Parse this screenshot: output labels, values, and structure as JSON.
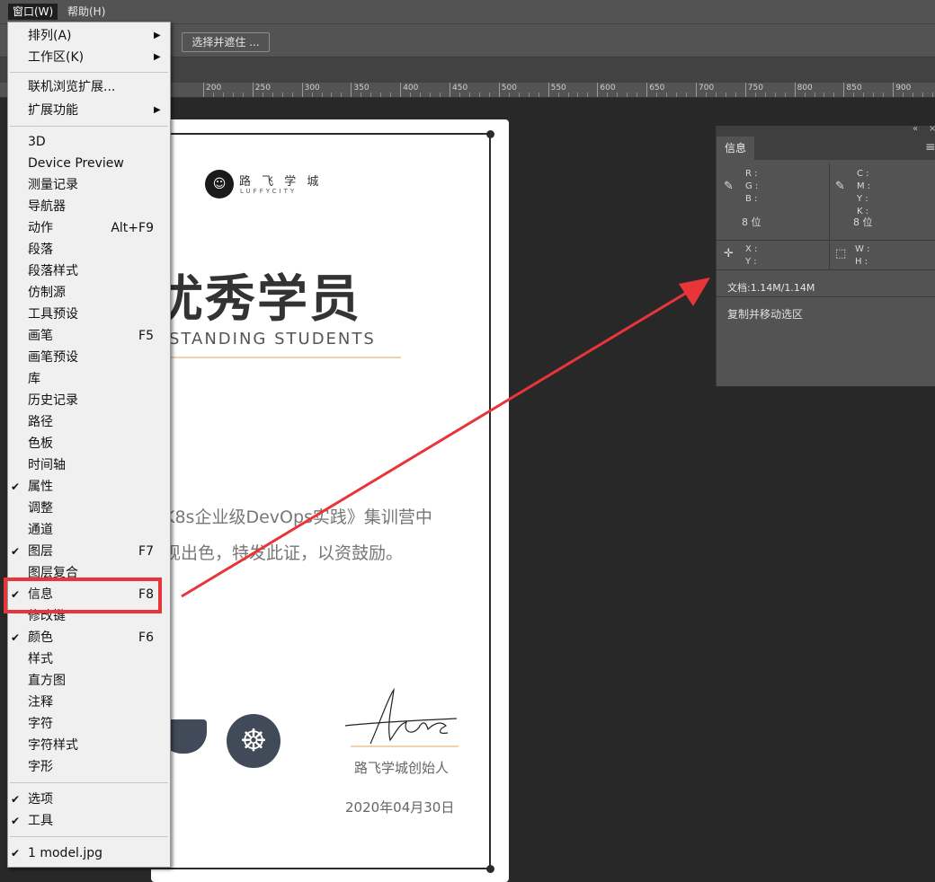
{
  "menubar": {
    "items": [
      {
        "label": "窗口(W)"
      },
      {
        "label": "帮助(H)"
      }
    ]
  },
  "options": {
    "select_mask_label": "选择并遮住 ..."
  },
  "ruler": {
    "labels": [
      "200",
      "250",
      "300",
      "350",
      "400",
      "450",
      "500",
      "550",
      "600",
      "650",
      "700",
      "750",
      "800",
      "850",
      "900"
    ]
  },
  "document": {
    "logo_cn": "路 飞 学 城",
    "logo_en": "LUFFYCITY",
    "title_cn": "优秀学员",
    "title_en": "STANDING STUDENTS",
    "body_line1": "K8s企业级DevOps实践》集训营中",
    "body_line2": "现出色，特发此证，以资鼓励。",
    "founder": "路飞学城创始人",
    "date": "2020年04月30日",
    "signature": "Alex"
  },
  "info_panel": {
    "tab": "信息",
    "rgb_labels": "R :\nG :\nB :",
    "cmyk_labels": "C :\nM :\nY :\nK :",
    "bit_left": "8 位",
    "bit_right": "8 位",
    "xy_labels": "X :\nY :",
    "wh_labels": "W :\nH :",
    "doc_info": "文档:1.14M/1.14M",
    "status": "复制并移动选区"
  },
  "dropdown": {
    "items": [
      {
        "label": "排列(A)",
        "submenu": true
      },
      {
        "label": "工作区(K)",
        "submenu": true
      },
      {
        "label": "联机浏览扩展..."
      },
      {
        "label": "扩展功能",
        "submenu": true
      },
      {
        "label": "3D"
      },
      {
        "label": "Device Preview"
      },
      {
        "label": "测量记录"
      },
      {
        "label": "导航器"
      },
      {
        "label": "动作",
        "shortcut": "Alt+F9"
      },
      {
        "label": "段落"
      },
      {
        "label": "段落样式"
      },
      {
        "label": "仿制源"
      },
      {
        "label": "工具预设"
      },
      {
        "label": "画笔",
        "shortcut": "F5"
      },
      {
        "label": "画笔预设"
      },
      {
        "label": "库"
      },
      {
        "label": "历史记录"
      },
      {
        "label": "路径"
      },
      {
        "label": "色板"
      },
      {
        "label": "时间轴"
      },
      {
        "label": "属性",
        "checked": true
      },
      {
        "label": "调整"
      },
      {
        "label": "通道"
      },
      {
        "label": "图层",
        "checked": true,
        "shortcut": "F7"
      },
      {
        "label": "图层复合"
      },
      {
        "label": "信息",
        "checked": true,
        "shortcut": "F8"
      },
      {
        "label": "修改键"
      },
      {
        "label": "颜色",
        "checked": true,
        "shortcut": "F6"
      },
      {
        "label": "样式"
      },
      {
        "label": "直方图"
      },
      {
        "label": "注释"
      },
      {
        "label": "字符"
      },
      {
        "label": "字符样式"
      },
      {
        "label": "字形"
      },
      {
        "label": "选项",
        "checked": true
      },
      {
        "label": "工具",
        "checked": true
      },
      {
        "label": "1 model.jpg",
        "checked": true
      }
    ]
  },
  "annotation": {
    "highlight_color": "#e8353a"
  }
}
